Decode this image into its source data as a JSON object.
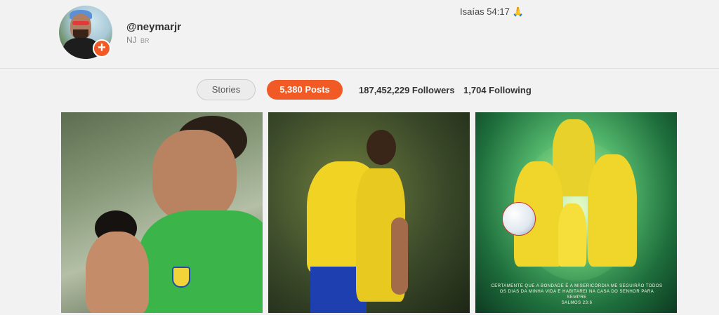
{
  "profile": {
    "username": "@neymarjr",
    "display_name": "NJ",
    "country_code": "BR",
    "bio": "Isaías 54:17",
    "bio_emoji": "🙏",
    "add_icon": "plus-icon"
  },
  "stats": {
    "stories_label": "Stories",
    "posts_label": "5,380 Posts",
    "followers_label": "187,452,229 Followers",
    "following_label": "1,704 Following"
  },
  "colors": {
    "accent": "#f15a24",
    "background": "#f2f2f2"
  },
  "posts": [
    {
      "type": "image",
      "alt": ""
    },
    {
      "type": "image",
      "alt": ""
    },
    {
      "type": "image",
      "overlay_text": "CERTAMENTE QUE A BONDADE E A MISERICÓRDIA ME SEGUIRÃO TODOS OS DIAS DA MINHA VIDA E HABITAREI NA CASA DO SENHOR PARA SEMPRE",
      "overlay_ref": "SALMOS 23:6"
    }
  ]
}
